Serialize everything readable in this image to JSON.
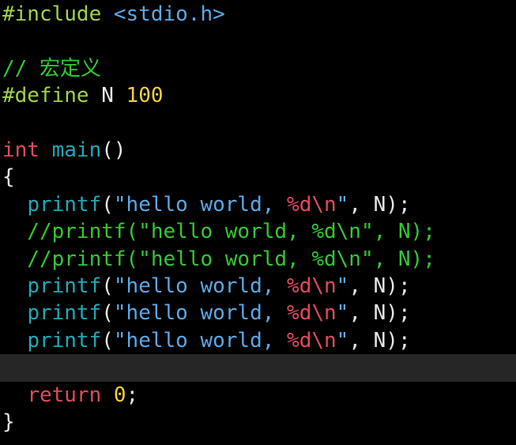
{
  "editor": {
    "colors": {
      "background": "#000000",
      "cursorline": "#262626",
      "preproc": "#a0d24a",
      "header": "#5aa9e6",
      "comment": "#32c832",
      "keyword": "#e04a5e",
      "function": "#1fa8b8",
      "string": "#5aa9e6",
      "format": "#e04a5e",
      "number": "#f2d23a",
      "default": "#e6e6e6"
    },
    "lines": [
      {
        "tokens": [
          {
            "t": "#include ",
            "c": "preproc"
          },
          {
            "t": "<stdio.h>",
            "c": "header"
          }
        ]
      },
      {
        "tokens": []
      },
      {
        "tokens": [
          {
            "t": "// 宏定义",
            "c": "comment"
          }
        ]
      },
      {
        "tokens": [
          {
            "t": "#define ",
            "c": "preproc"
          },
          {
            "t": "N ",
            "c": "default"
          },
          {
            "t": "100",
            "c": "number"
          }
        ]
      },
      {
        "tokens": []
      },
      {
        "tokens": [
          {
            "t": "int ",
            "c": "keyword"
          },
          {
            "t": "main",
            "c": "function"
          },
          {
            "t": "()",
            "c": "default"
          }
        ]
      },
      {
        "tokens": [
          {
            "t": "{",
            "c": "default"
          }
        ]
      },
      {
        "tokens": [
          {
            "t": "  ",
            "c": "default"
          },
          {
            "t": "printf",
            "c": "function"
          },
          {
            "t": "(",
            "c": "default"
          },
          {
            "t": "\"hello world, ",
            "c": "string"
          },
          {
            "t": "%d\\n",
            "c": "format"
          },
          {
            "t": "\"",
            "c": "string"
          },
          {
            "t": ", N);",
            "c": "default"
          }
        ]
      },
      {
        "tokens": [
          {
            "t": "  //printf(\"hello world, %d\\n\", N);",
            "c": "comment"
          }
        ]
      },
      {
        "tokens": [
          {
            "t": "  //printf(\"hello world, %d\\n\", N);",
            "c": "comment"
          }
        ]
      },
      {
        "tokens": [
          {
            "t": "  ",
            "c": "default"
          },
          {
            "t": "printf",
            "c": "function"
          },
          {
            "t": "(",
            "c": "default"
          },
          {
            "t": "\"hello world, ",
            "c": "string"
          },
          {
            "t": "%d\\n",
            "c": "format"
          },
          {
            "t": "\"",
            "c": "string"
          },
          {
            "t": ", N);",
            "c": "default"
          }
        ]
      },
      {
        "tokens": [
          {
            "t": "  ",
            "c": "default"
          },
          {
            "t": "printf",
            "c": "function"
          },
          {
            "t": "(",
            "c": "default"
          },
          {
            "t": "\"hello world, ",
            "c": "string"
          },
          {
            "t": "%d\\n",
            "c": "format"
          },
          {
            "t": "\"",
            "c": "string"
          },
          {
            "t": ", N);",
            "c": "default"
          }
        ]
      },
      {
        "tokens": [
          {
            "t": "  ",
            "c": "default"
          },
          {
            "t": "printf",
            "c": "function"
          },
          {
            "t": "(",
            "c": "default"
          },
          {
            "t": "\"hello world, ",
            "c": "string"
          },
          {
            "t": "%d\\n",
            "c": "format"
          },
          {
            "t": "\"",
            "c": "string"
          },
          {
            "t": ", N);",
            "c": "default"
          }
        ]
      },
      {
        "tokens": [],
        "cursorline": true
      },
      {
        "tokens": [
          {
            "t": "  ",
            "c": "default"
          },
          {
            "t": "return ",
            "c": "keyword"
          },
          {
            "t": "0",
            "c": "number"
          },
          {
            "t": ";",
            "c": "default"
          }
        ]
      },
      {
        "tokens": [
          {
            "t": "}",
            "c": "default"
          }
        ]
      }
    ]
  }
}
